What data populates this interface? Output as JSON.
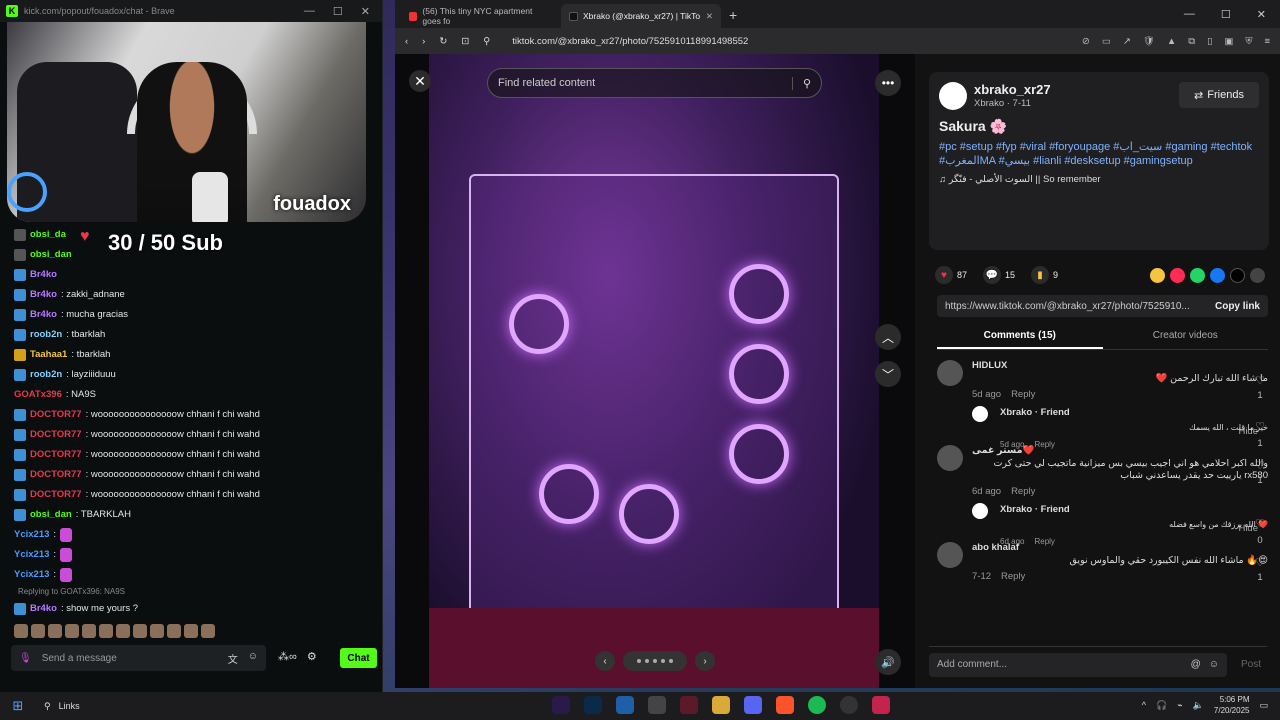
{
  "kick": {
    "window_title": "kick.com/popout/fouadox/chat - Brave",
    "streamer_name": "fouadox",
    "sub_goal": "30  / 50 Sub",
    "messages": [
      {
        "user": "obsi_da",
        "text": "",
        "color": "#53fc18",
        "badge": "ava"
      },
      {
        "user": "obsi_dan",
        "text": "",
        "color": "#53fc18",
        "badge": "ava"
      },
      {
        "user": "Br4ko",
        "text": "",
        "color": "#b57bff",
        "badge": "blue"
      },
      {
        "user": "Br4ko",
        "text": ": zakki_adnane",
        "color": "#b57bff",
        "badge": "blue"
      },
      {
        "user": "Br4ko",
        "text": ": mucha gracias",
        "color": "#b57bff",
        "badge": "blue"
      },
      {
        "user": "roob2n",
        "text": ": tbarklah",
        "color": "#7fd3ff",
        "badge": "blue"
      },
      {
        "user": "Taahaa1",
        "text": ": tbarklah",
        "color": "#f5c542",
        "badge": "gold"
      },
      {
        "user": "roob2n",
        "text": ": layziiiduuu",
        "color": "#7fd3ff",
        "badge": "blue"
      },
      {
        "user": "GOATx396",
        "text": ": NA9S",
        "color": "#e8384f",
        "badge": "none"
      },
      {
        "user": "DOCTOR77",
        "text": ": wooooooooooooooow chhani f chi wahd",
        "color": "#e8384f",
        "badge": "blue"
      },
      {
        "user": "DOCTOR77",
        "text": ": wooooooooooooooow chhani f chi wahd",
        "color": "#e8384f",
        "badge": "blue"
      },
      {
        "user": "DOCTOR77",
        "text": ": wooooooooooooooow chhani f chi wahd",
        "color": "#e8384f",
        "badge": "blue"
      },
      {
        "user": "DOCTOR77",
        "text": ": wooooooooooooooow chhani f chi wahd",
        "color": "#e8384f",
        "badge": "blue"
      },
      {
        "user": "DOCTOR77",
        "text": ": wooooooooooooooow chhani f chi wahd",
        "color": "#e8384f",
        "badge": "blue"
      },
      {
        "user": "obsi_dan",
        "text": ": TBARKLAH",
        "color": "#53fc18",
        "badge": "blue"
      },
      {
        "user": "Ycix213",
        "text": ":",
        "color": "#4a9cff",
        "badge": "none"
      },
      {
        "user": "Ycix213",
        "text": ":",
        "color": "#4a9cff",
        "badge": "none"
      },
      {
        "user": "Ycix213",
        "text": ":",
        "color": "#4a9cff",
        "badge": "none"
      }
    ],
    "reply_context": "Replying to GOATx396: NA9S",
    "reply_msg": {
      "user": "Br4ko",
      "text": ": show me yours ?"
    },
    "input_placeholder": "Send a message",
    "chat_button": "Chat"
  },
  "brave": {
    "tab1": "(56) This tiny NYC apartment goes fo",
    "tab2": "Xbrako (@xbrako_xr27) | TikTo",
    "url": "tiktok.com/@xbrako_xr27/photo/7525910118991498552"
  },
  "viewer": {
    "search_placeholder": "Find related content"
  },
  "post": {
    "username": "xbrako_xr27",
    "subline": "Xbrako · 7-11",
    "friends_label": "Friends",
    "title": "Sakura 🌸",
    "tags": "#pc #setup #fyp #viral #foryoupage #سيت_اب #gaming #techtok #المغربMA #بيسي #lianli #desksetup #gamingsetup",
    "sound": "السوت الأصلي - فنّگر || So remember",
    "likes": "87",
    "comments_count": "15",
    "saves": "9",
    "link": "https://www.tiktok.com/@xbrako_xr27/photo/7525910...",
    "copy_link": "Copy link",
    "tab_comments": "Comments (15)",
    "tab_creator": "Creator videos",
    "add_comment": "Add comment...",
    "post_label": "Post"
  },
  "comments": [
    {
      "name": "HIDLUX",
      "text": "ما شاء الله تبارك الرحمن ❤️",
      "date": "5d ago",
      "reply": "Reply",
      "likes": "1",
      "type": "top"
    },
    {
      "name": "Xbrako · Friend",
      "text": "خير ما قلت ، الله يسمك",
      "date": "5d ago",
      "reply": "Reply",
      "likes": "1",
      "type": "reply"
    },
    {
      "name": "مستر غمى❤️",
      "text": "والله اكبر احلامي هو اني اجيب بيسي بس ميزانية ماتجيب لي حتى كرت rx580 يارييت حد يقدر يساعدني شباب",
      "date": "6d ago",
      "reply": "Reply",
      "likes": "1",
      "type": "top"
    },
    {
      "name": "Xbrako · Friend",
      "text": "❤️ الله يرزقك من واسع فضله",
      "date": "6d ago",
      "reply": "Reply",
      "likes": "0",
      "type": "reply"
    },
    {
      "name": "abo khalaf",
      "text": "😍🔥 ماشاء الله نفس الكيبورد حقي والماوس نويق",
      "date": "7-12",
      "reply": "Reply",
      "likes": "1",
      "type": "top"
    }
  ],
  "hide_label": "Hide",
  "taskbar": {
    "search_label": "Links",
    "time": "5:06 PM",
    "date": "7/20/2025"
  }
}
